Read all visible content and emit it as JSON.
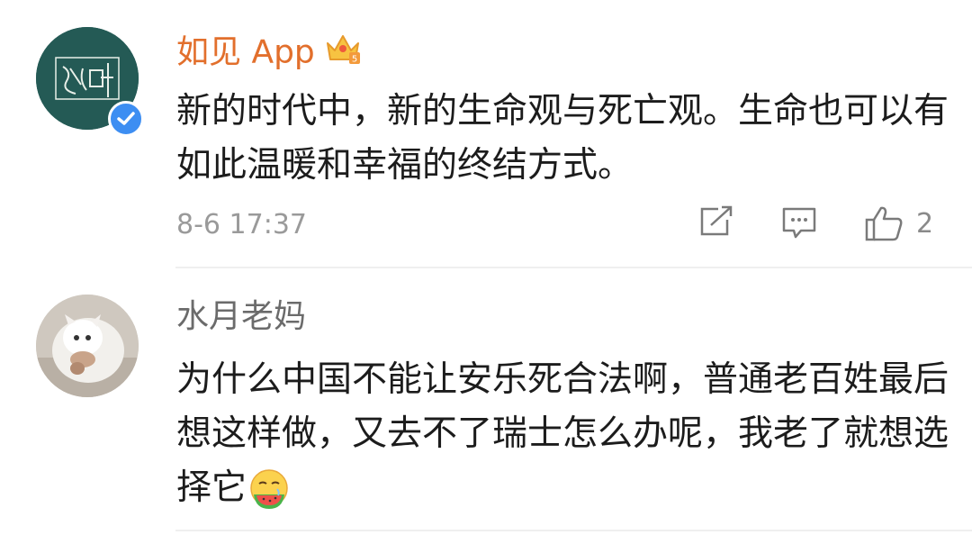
{
  "comments": [
    {
      "username": "如见 App",
      "verified": true,
      "vip_badge": "crown-icon",
      "text": "新的时代中，新的生命观与死亡观。生命也可以有如此温暖和幸福的终结方式。",
      "timestamp": "8-6 17:37",
      "actions": {
        "share_icon": "share-icon",
        "comment_icon": "comment-icon",
        "like_icon": "thumbs-up-icon",
        "like_count": "2"
      },
      "colors": {
        "username": "#e26f2c",
        "avatar_bg": "#245a55",
        "verified": "#3d8ef2"
      }
    },
    {
      "username": "水月老妈",
      "text": "为什么中国不能让安乐死合法啊，普通老百姓最后想这样做，又去不了瑞士怎么办呢，我老了就想选择它",
      "emoji": "drooling-watermelon-emoji"
    }
  ]
}
